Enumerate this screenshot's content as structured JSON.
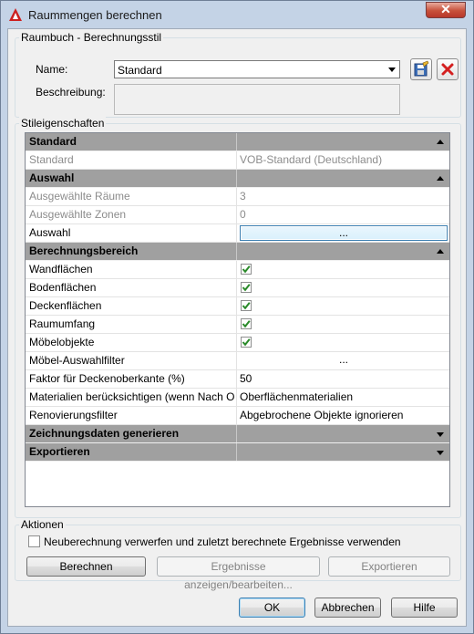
{
  "window": {
    "title": "Raummengen berechnen"
  },
  "colors": {
    "checkmark": "#2a8a2a",
    "delete_icon": "#d42020",
    "title_icon": "#cc2020"
  },
  "raumbuch": {
    "group_label": "Raumbuch - Berechnungsstil",
    "name_label": "Name:",
    "name_value": "Standard",
    "description_label": "Beschreibung:",
    "description_value": ""
  },
  "properties": {
    "group_label": "Stileigenschaften",
    "rows": [
      {
        "type": "category",
        "label": "Standard",
        "collapse": "up"
      },
      {
        "type": "text",
        "label": "Standard",
        "value": "VOB-Standard (Deutschland)",
        "disabled": true
      },
      {
        "type": "category",
        "label": "Auswahl",
        "collapse": "up"
      },
      {
        "type": "text",
        "label": "Ausgewählte Räume",
        "value": "3",
        "disabled": true
      },
      {
        "type": "text",
        "label": "Ausgewählte Zonen",
        "value": "0",
        "disabled": true
      },
      {
        "type": "button",
        "label": "Auswahl",
        "value": "...",
        "focused": true
      },
      {
        "type": "category",
        "label": "Berechnungsbereich",
        "collapse": "up"
      },
      {
        "type": "check",
        "label": "Wandflächen",
        "checked": true
      },
      {
        "type": "check",
        "label": "Bodenflächen",
        "checked": true
      },
      {
        "type": "check",
        "label": "Deckenflächen",
        "checked": true
      },
      {
        "type": "check",
        "label": "Raumumfang",
        "checked": true
      },
      {
        "type": "check",
        "label": "Möbelobjekte",
        "checked": true
      },
      {
        "type": "button",
        "label": "Möbel-Auswahlfilter",
        "value": "..."
      },
      {
        "type": "text",
        "label": "Faktor für Deckenoberkante (%)",
        "value": "50"
      },
      {
        "type": "text",
        "label": "Materialien berücksichtigen (wenn Nach O",
        "value": "Oberflächenmaterialien"
      },
      {
        "type": "text",
        "label": "Renovierungsfilter",
        "value": "Abgebrochene Objekte ignorieren"
      },
      {
        "type": "category",
        "label": "Zeichnungsdaten generieren",
        "collapse": "down"
      },
      {
        "type": "category",
        "label": "Exportieren",
        "collapse": "down"
      }
    ]
  },
  "actions": {
    "group_label": "Aktionen",
    "discard_checkbox_label": "Neuberechnung verwerfen und zuletzt berechnete Ergebnisse verwenden",
    "calculate_label": "Berechnen",
    "show_results_label": "Ergebnisse anzeigen/bearbeiten...",
    "export_label": "Exportieren"
  },
  "footer": {
    "ok_label": "OK",
    "cancel_label": "Abbrechen",
    "help_label": "Hilfe"
  }
}
